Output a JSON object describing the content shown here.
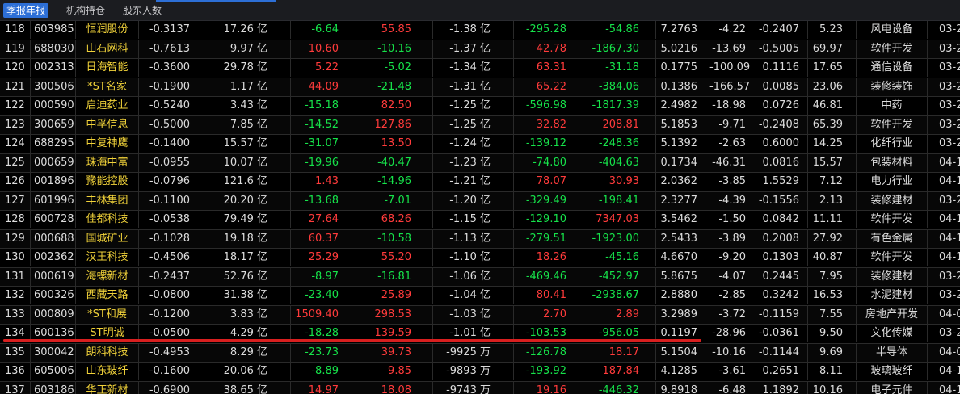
{
  "tabs": [
    {
      "label": "季报年报",
      "active": true
    },
    {
      "label": "机构持仓",
      "active": false
    },
    {
      "label": "股东人数",
      "active": false
    }
  ],
  "colors": {
    "up": "#ff3b3b",
    "down": "#16e24a",
    "stock_name": "#f2d33a",
    "active_tab": "#2d6fd6",
    "highlight_line": "#d81f1f"
  },
  "highlighted_row_index": 16,
  "rows": [
    {
      "idx": "118",
      "code": "603985",
      "name": "恒润股份",
      "a": "-0.3137",
      "cap": "17.26 亿",
      "b": "-6.64",
      "c": "55.85",
      "flow": "-1.38 亿",
      "d": "-295.28",
      "e": "-54.86",
      "f": "7.2763",
      "g": "-4.22",
      "h": "-0.2407",
      "i": "5.23",
      "ind": "风电设备",
      "date": "03-2",
      "dirs": {
        "b": "green",
        "c": "red",
        "d": "green",
        "e": "green"
      }
    },
    {
      "idx": "119",
      "code": "688030",
      "name": "山石网科",
      "a": "-0.7613",
      "cap": "9.97 亿",
      "b": "10.60",
      "c": "-10.16",
      "flow": "-1.37 亿",
      "d": "42.78",
      "e": "-1867.30",
      "f": "5.0216",
      "g": "-13.69",
      "h": "-0.5005",
      "i": "69.97",
      "ind": "软件开发",
      "date": "03-2",
      "dirs": {
        "b": "red",
        "c": "green",
        "d": "red",
        "e": "green"
      }
    },
    {
      "idx": "120",
      "code": "002313",
      "name": "日海智能",
      "a": "-0.3600",
      "cap": "29.78 亿",
      "b": "5.22",
      "c": "-5.02",
      "flow": "-1.34 亿",
      "d": "63.31",
      "e": "-31.18",
      "f": "0.1775",
      "g": "-100.09",
      "h": "0.1116",
      "i": "17.65",
      "ind": "通信设备",
      "date": "03-2",
      "dirs": {
        "b": "red",
        "c": "green",
        "d": "red",
        "e": "green"
      }
    },
    {
      "idx": "121",
      "code": "300506",
      "name": "*ST名家",
      "a": "-0.1900",
      "cap": "1.17 亿",
      "b": "44.09",
      "c": "-21.48",
      "flow": "-1.31 亿",
      "d": "65.22",
      "e": "-384.06",
      "f": "0.1386",
      "g": "-166.57",
      "h": "0.0085",
      "i": "23.06",
      "ind": "装修装饰",
      "date": "03-2",
      "dirs": {
        "b": "red",
        "c": "green",
        "d": "red",
        "e": "green"
      }
    },
    {
      "idx": "122",
      "code": "000590",
      "name": "启迪药业",
      "a": "-0.5240",
      "cap": "3.43 亿",
      "b": "-15.18",
      "c": "82.50",
      "flow": "-1.25 亿",
      "d": "-596.98",
      "e": "-1817.39",
      "f": "2.4982",
      "g": "-18.98",
      "h": "0.0726",
      "i": "46.81",
      "ind": "中药",
      "date": "03-2",
      "dirs": {
        "b": "green",
        "c": "red",
        "d": "green",
        "e": "green"
      }
    },
    {
      "idx": "123",
      "code": "300659",
      "name": "中孚信息",
      "a": "-0.5000",
      "cap": "7.85 亿",
      "b": "-14.52",
      "c": "127.86",
      "flow": "-1.25 亿",
      "d": "32.82",
      "e": "208.81",
      "f": "5.1853",
      "g": "-9.71",
      "h": "-0.2408",
      "i": "65.39",
      "ind": "软件开发",
      "date": "03-2",
      "dirs": {
        "b": "green",
        "c": "red",
        "d": "red",
        "e": "red"
      }
    },
    {
      "idx": "124",
      "code": "688295",
      "name": "中复神鹰",
      "a": "-0.1400",
      "cap": "15.57 亿",
      "b": "-31.07",
      "c": "13.50",
      "flow": "-1.24 亿",
      "d": "-139.12",
      "e": "-248.36",
      "f": "5.1392",
      "g": "-2.63",
      "h": "0.6000",
      "i": "14.25",
      "ind": "化纤行业",
      "date": "03-2",
      "dirs": {
        "b": "green",
        "c": "red",
        "d": "green",
        "e": "green"
      }
    },
    {
      "idx": "125",
      "code": "000659",
      "name": "珠海中富",
      "a": "-0.0955",
      "cap": "10.07 亿",
      "b": "-19.96",
      "c": "-40.47",
      "flow": "-1.23 亿",
      "d": "-74.80",
      "e": "-404.63",
      "f": "0.1734",
      "g": "-46.31",
      "h": "0.0816",
      "i": "15.57",
      "ind": "包装材料",
      "date": "04-1",
      "dirs": {
        "b": "green",
        "c": "green",
        "d": "green",
        "e": "green"
      }
    },
    {
      "idx": "126",
      "code": "001896",
      "name": "豫能控股",
      "a": "-0.0796",
      "cap": "121.6 亿",
      "b": "1.43",
      "c": "-14.96",
      "flow": "-1.21 亿",
      "d": "78.07",
      "e": "30.93",
      "f": "2.0362",
      "g": "-3.85",
      "h": "1.5529",
      "i": "7.12",
      "ind": "电力行业",
      "date": "04-1",
      "dirs": {
        "b": "red",
        "c": "green",
        "d": "red",
        "e": "red"
      }
    },
    {
      "idx": "127",
      "code": "601996",
      "name": "丰林集团",
      "a": "-0.1100",
      "cap": "20.20 亿",
      "b": "-13.68",
      "c": "-7.01",
      "flow": "-1.20 亿",
      "d": "-329.49",
      "e": "-198.41",
      "f": "2.3277",
      "g": "-4.39",
      "h": "-0.1556",
      "i": "2.13",
      "ind": "装修建材",
      "date": "03-2",
      "dirs": {
        "b": "green",
        "c": "green",
        "d": "green",
        "e": "green"
      }
    },
    {
      "idx": "128",
      "code": "600728",
      "name": "佳都科技",
      "a": "-0.0538",
      "cap": "79.49 亿",
      "b": "27.64",
      "c": "68.26",
      "flow": "-1.15 亿",
      "d": "-129.10",
      "e": "7347.03",
      "f": "3.5462",
      "g": "-1.50",
      "h": "0.0842",
      "i": "11.11",
      "ind": "软件开发",
      "date": "04-1",
      "dirs": {
        "b": "red",
        "c": "red",
        "d": "green",
        "e": "red"
      }
    },
    {
      "idx": "129",
      "code": "000688",
      "name": "国城矿业",
      "a": "-0.1028",
      "cap": "19.18 亿",
      "b": "60.37",
      "c": "-10.58",
      "flow": "-1.13 亿",
      "d": "-279.51",
      "e": "-1923.00",
      "f": "2.5433",
      "g": "-3.89",
      "h": "0.2008",
      "i": "27.92",
      "ind": "有色金属",
      "date": "04-1",
      "dirs": {
        "b": "red",
        "c": "green",
        "d": "green",
        "e": "green"
      }
    },
    {
      "idx": "130",
      "code": "002362",
      "name": "汉王科技",
      "a": "-0.4506",
      "cap": "18.17 亿",
      "b": "25.29",
      "c": "55.20",
      "flow": "-1.10 亿",
      "d": "18.26",
      "e": "-45.16",
      "f": "4.6670",
      "g": "-9.20",
      "h": "0.1303",
      "i": "40.87",
      "ind": "软件开发",
      "date": "04-1",
      "dirs": {
        "b": "red",
        "c": "red",
        "d": "red",
        "e": "green"
      }
    },
    {
      "idx": "131",
      "code": "000619",
      "name": "海螺新材",
      "a": "-0.2437",
      "cap": "52.76 亿",
      "b": "-8.97",
      "c": "-16.81",
      "flow": "-1.06 亿",
      "d": "-469.46",
      "e": "-452.97",
      "f": "5.8675",
      "g": "-4.07",
      "h": "0.2445",
      "i": "7.95",
      "ind": "装修建材",
      "date": "03-2",
      "dirs": {
        "b": "green",
        "c": "green",
        "d": "green",
        "e": "green"
      }
    },
    {
      "idx": "132",
      "code": "600326",
      "name": "西藏天路",
      "a": "-0.0800",
      "cap": "31.38 亿",
      "b": "-23.40",
      "c": "25.89",
      "flow": "-1.04 亿",
      "d": "80.41",
      "e": "-2938.67",
      "f": "2.8880",
      "g": "-2.85",
      "h": "0.3242",
      "i": "16.53",
      "ind": "水泥建材",
      "date": "03-2",
      "dirs": {
        "b": "green",
        "c": "red",
        "d": "red",
        "e": "green"
      }
    },
    {
      "idx": "133",
      "code": "000809",
      "name": "*ST和展",
      "a": "-0.1200",
      "cap": "3.83 亿",
      "b": "1509.40",
      "c": "298.53",
      "flow": "-1.03 亿",
      "d": "2.70",
      "e": "2.89",
      "f": "3.2989",
      "g": "-3.72",
      "h": "-0.1159",
      "i": "7.55",
      "ind": "房地产开发",
      "date": "04-0",
      "dirs": {
        "b": "red",
        "c": "red",
        "d": "red",
        "e": "red"
      }
    },
    {
      "idx": "134",
      "code": "600136",
      "name": "ST明诚",
      "a": "-0.0500",
      "cap": "4.29 亿",
      "b": "-18.28",
      "c": "139.59",
      "flow": "-1.01 亿",
      "d": "-103.53",
      "e": "-956.05",
      "f": "0.1197",
      "g": "-28.96",
      "h": "-0.0361",
      "i": "9.50",
      "ind": "文化传媒",
      "date": "03-2",
      "dirs": {
        "b": "green",
        "c": "red",
        "d": "green",
        "e": "green"
      }
    },
    {
      "idx": "135",
      "code": "300042",
      "name": "朗科科技",
      "a": "-0.4953",
      "cap": "8.29 亿",
      "b": "-23.73",
      "c": "39.73",
      "flow": "-9925 万",
      "d": "-126.78",
      "e": "18.17",
      "f": "5.1504",
      "g": "-10.16",
      "h": "-0.1144",
      "i": "9.69",
      "ind": "半导体",
      "date": "04-0",
      "dirs": {
        "b": "green",
        "c": "red",
        "d": "green",
        "e": "red"
      }
    },
    {
      "idx": "136",
      "code": "605006",
      "name": "山东玻纤",
      "a": "-0.1600",
      "cap": "20.06 亿",
      "b": "-8.89",
      "c": "9.85",
      "flow": "-9893 万",
      "d": "-193.92",
      "e": "187.84",
      "f": "4.1285",
      "g": "-3.61",
      "h": "0.2651",
      "i": "8.11",
      "ind": "玻璃玻纤",
      "date": "04-1",
      "dirs": {
        "b": "green",
        "c": "red",
        "d": "green",
        "e": "red"
      }
    },
    {
      "idx": "137",
      "code": "603186",
      "name": "华正新材",
      "a": "-0.6900",
      "cap": "38.65 亿",
      "b": "14.97",
      "c": "18.08",
      "flow": "-9743 万",
      "d": "19.16",
      "e": "-446.32",
      "f": "9.8918",
      "g": "-6.48",
      "h": "1.1892",
      "i": "10.16",
      "ind": "电子元件",
      "date": "04-1",
      "dirs": {
        "b": "red",
        "c": "red",
        "d": "red",
        "e": "green"
      }
    }
  ]
}
